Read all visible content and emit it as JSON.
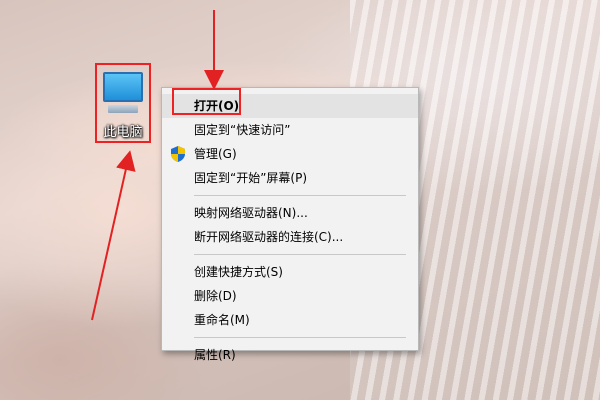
{
  "desktop": {
    "icon_label": "此电脑"
  },
  "context_menu": {
    "items": [
      {
        "label": "打开(O)"
      },
      {
        "label": "固定到“快速访问”"
      },
      {
        "label": "管理(G)",
        "icon": "uac-shield-icon"
      },
      {
        "label": "固定到“开始”屏幕(P)"
      },
      {
        "label": "映射网络驱动器(N)..."
      },
      {
        "label": "断开网络驱动器的连接(C)..."
      },
      {
        "label": "创建快捷方式(S)"
      },
      {
        "label": "删除(D)"
      },
      {
        "label": "重命名(M)"
      },
      {
        "label": "属性(R)"
      }
    ]
  },
  "colors": {
    "annotation": "#e22222",
    "menu_bg": "#f2f2f2",
    "menu_hover": "#e3e3e3"
  }
}
